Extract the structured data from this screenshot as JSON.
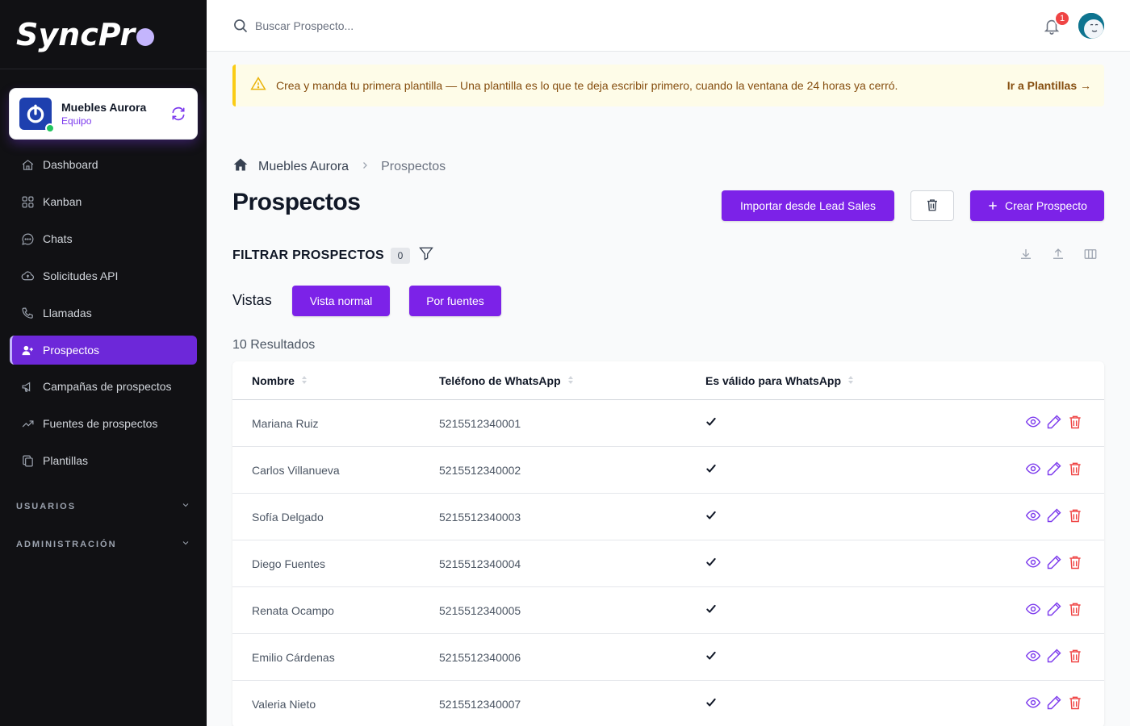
{
  "app": {
    "logo_main": "SyncPr",
    "logo_last": ""
  },
  "team": {
    "name": "Muebles Aurora",
    "role": "Equipo"
  },
  "sidebar": {
    "items": [
      {
        "label": "Dashboard",
        "icon": "home-icon"
      },
      {
        "label": "Kanban",
        "icon": "grid-icon"
      },
      {
        "label": "Chats",
        "icon": "chat-icon"
      },
      {
        "label": "Solicitudes API",
        "icon": "cloud-icon"
      },
      {
        "label": "Llamadas",
        "icon": "phone-icon"
      },
      {
        "label": "Prospectos",
        "icon": "user-plus-icon",
        "active": true
      },
      {
        "label": "Campañas de prospectos",
        "icon": "megaphone-icon"
      },
      {
        "label": "Fuentes de prospectos",
        "icon": "trend-icon"
      },
      {
        "label": "Plantillas",
        "icon": "copy-icon"
      }
    ],
    "sections": [
      "USUARIOS",
      "ADMINISTRACIÓN"
    ]
  },
  "search": {
    "placeholder": "Buscar Prospecto..."
  },
  "notifications": {
    "count": "1"
  },
  "alert": {
    "text": "Crea y manda tu primera plantilla — Una plantilla es lo que te deja escribir primero, cuando la ventana de 24 horas ya cerró.",
    "link": "Ir a Plantillas →"
  },
  "breadcrumb": {
    "root": "Muebles Aurora",
    "current": "Prospectos"
  },
  "page": {
    "title": "Prospectos",
    "import_label": "Importar desde Lead Sales",
    "create_label": "Crear Prospecto",
    "filter_label": "FILTRAR PROSPECTOS",
    "filter_count": "0",
    "views_label": "Vistas",
    "view_normal": "Vista normal",
    "view_sources": "Por fuentes",
    "results": "10 Resultados"
  },
  "table": {
    "columns": [
      "Nombre",
      "Teléfono de WhatsApp",
      "Es válido para WhatsApp"
    ],
    "rows": [
      {
        "name": "Mariana Ruiz",
        "phone": "5215512340001",
        "valid": "✔"
      },
      {
        "name": "Carlos Villanueva",
        "phone": "5215512340002",
        "valid": "✔"
      },
      {
        "name": "Sofía Delgado",
        "phone": "5215512340003",
        "valid": "✔"
      },
      {
        "name": "Diego Fuentes",
        "phone": "5215512340004",
        "valid": "✔"
      },
      {
        "name": "Renata Ocampo",
        "phone": "5215512340005",
        "valid": "✔"
      },
      {
        "name": "Emilio Cárdenas",
        "phone": "5215512340006",
        "valid": "✔"
      },
      {
        "name": "Valeria Nieto",
        "phone": "5215512340007",
        "valid": "✔"
      }
    ]
  },
  "colors": {
    "sidebar_bg": "#111114",
    "primary": "#7c22e8",
    "alert_bg": "#fefce8",
    "danger": "#ef4444"
  }
}
